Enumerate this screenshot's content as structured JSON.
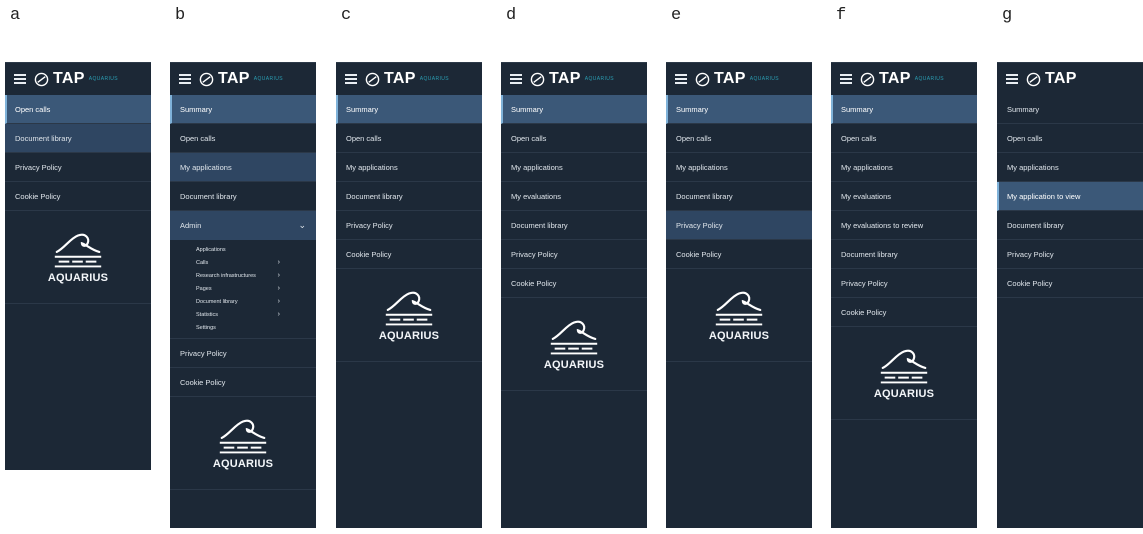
{
  "panels": [
    {
      "letter": "a",
      "brand": "TAP",
      "brand_sub": "AQUARIUS",
      "items": [
        {
          "label": "Open calls"
        },
        {
          "label": "Document library"
        },
        {
          "label": "Privacy Policy"
        },
        {
          "label": "Cookie Policy"
        }
      ],
      "logo_text": "AQUARIUS"
    },
    {
      "letter": "b",
      "brand": "TAP",
      "brand_sub": "AQUARIUS",
      "items": [
        {
          "label": "Summary"
        },
        {
          "label": "Open calls"
        },
        {
          "label": "My applications"
        },
        {
          "label": "Document library"
        },
        {
          "label": "Admin"
        },
        {
          "label": "Privacy Policy"
        },
        {
          "label": "Cookie Policy"
        }
      ],
      "admin_sub": [
        {
          "label": "Applications"
        },
        {
          "label": "Calls"
        },
        {
          "label": "Research infrastructures"
        },
        {
          "label": "Pages"
        },
        {
          "label": "Document library"
        },
        {
          "label": "Statistics"
        },
        {
          "label": "Settings"
        }
      ],
      "logo_text": "AQUARIUS"
    },
    {
      "letter": "c",
      "brand": "TAP",
      "brand_sub": "AQUARIUS",
      "items": [
        {
          "label": "Summary"
        },
        {
          "label": "Open calls"
        },
        {
          "label": "My applications"
        },
        {
          "label": "Document library"
        },
        {
          "label": "Privacy Policy"
        },
        {
          "label": "Cookie Policy"
        }
      ],
      "logo_text": "AQUARIUS"
    },
    {
      "letter": "d",
      "brand": "TAP",
      "brand_sub": "AQUARIUS",
      "items": [
        {
          "label": "Summary"
        },
        {
          "label": "Open calls"
        },
        {
          "label": "My applications"
        },
        {
          "label": "My evaluations"
        },
        {
          "label": "Document library"
        },
        {
          "label": "Privacy Policy"
        },
        {
          "label": "Cookie Policy"
        }
      ],
      "logo_text": "AQUARIUS"
    },
    {
      "letter": "e",
      "brand": "TAP",
      "brand_sub": "AQUARIUS",
      "items": [
        {
          "label": "Summary"
        },
        {
          "label": "Open calls"
        },
        {
          "label": "My applications"
        },
        {
          "label": "Document library"
        },
        {
          "label": "Privacy Policy"
        },
        {
          "label": "Cookie Policy"
        }
      ],
      "logo_text": "AQUARIUS"
    },
    {
      "letter": "f",
      "brand": "TAP",
      "brand_sub": "AQUARIUS",
      "items": [
        {
          "label": "Summary"
        },
        {
          "label": "Open calls"
        },
        {
          "label": "My applications"
        },
        {
          "label": "My evaluations"
        },
        {
          "label": "My evaluations to review"
        },
        {
          "label": "Document library"
        },
        {
          "label": "Privacy Policy"
        },
        {
          "label": "Cookie Policy"
        }
      ],
      "logo_text": "AQUARIUS"
    },
    {
      "letter": "g",
      "brand": "TAP",
      "items": [
        {
          "label": "Summary"
        },
        {
          "label": "Open calls"
        },
        {
          "label": "My applications"
        },
        {
          "label": "My application to view"
        },
        {
          "label": "Document library"
        },
        {
          "label": "Privacy Policy"
        },
        {
          "label": "Cookie Policy"
        }
      ]
    }
  ],
  "colors": {
    "panel_bg": "#1c2836",
    "active_bg": "#3b5878",
    "accent": "#2a9bb0",
    "text": "#dfe5eb"
  }
}
